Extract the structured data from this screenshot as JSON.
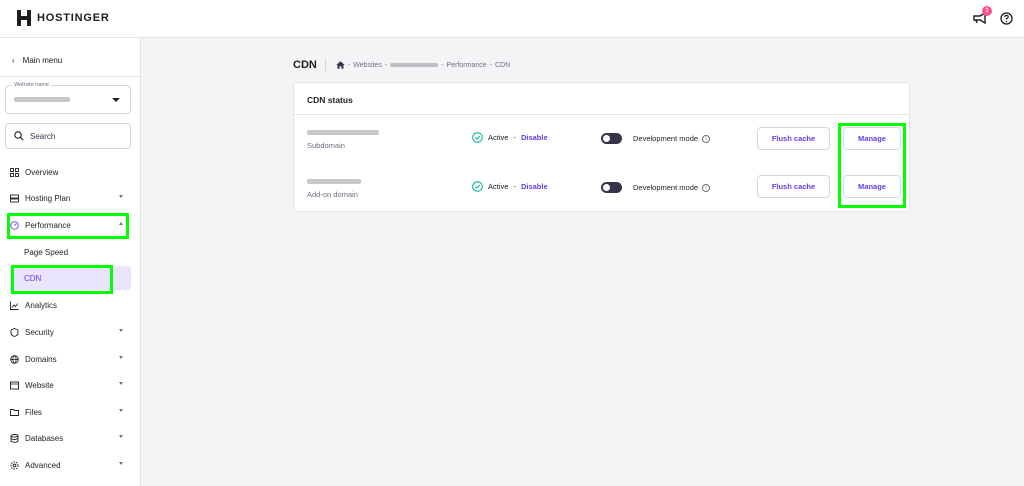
{
  "brand": {
    "name": "HOSTINGER"
  },
  "topbar": {
    "notification_count": "1",
    "icons": [
      "megaphone-icon",
      "help-icon"
    ]
  },
  "sidebar": {
    "main_menu": "Main menu",
    "website_select": {
      "label": "Website name"
    },
    "search": {
      "placeholder": "Search"
    },
    "items": [
      {
        "label": "Overview",
        "icon": "grid-icon"
      },
      {
        "label": "Hosting Plan",
        "icon": "server-icon"
      },
      {
        "label": "Performance",
        "icon": "gauge-icon"
      },
      {
        "label": "Page Speed"
      },
      {
        "label": "CDN"
      },
      {
        "label": "Analytics",
        "icon": "chart-line-icon"
      },
      {
        "label": "Security",
        "icon": "shield-icon"
      },
      {
        "label": "Domains",
        "icon": "globe-icon"
      },
      {
        "label": "Website",
        "icon": "window-icon"
      },
      {
        "label": "Files",
        "icon": "folder-icon"
      },
      {
        "label": "Databases",
        "icon": "database-icon"
      },
      {
        "label": "Advanced",
        "icon": "gear-icon"
      }
    ]
  },
  "breadcrumb": {
    "title": "CDN",
    "sep": "-",
    "websites": "Websites",
    "performance": "Performance",
    "current": "CDN"
  },
  "card": {
    "title": "CDN status",
    "rows": [
      {
        "type": "Subdomain",
        "status": "Active",
        "dash": "-",
        "disable": "Disable",
        "dev_mode": "Development mode",
        "flush": "Flush cache",
        "manage": "Manage"
      },
      {
        "type": "Add-on domain",
        "status": "Active",
        "dash": "-",
        "disable": "Disable",
        "dev_mode": "Development mode",
        "flush": "Flush cache",
        "manage": "Manage"
      }
    ]
  },
  "colors": {
    "accent": "#673de6",
    "success": "#00b090",
    "badge": "#fc5185",
    "highlight": "#00ff00"
  }
}
